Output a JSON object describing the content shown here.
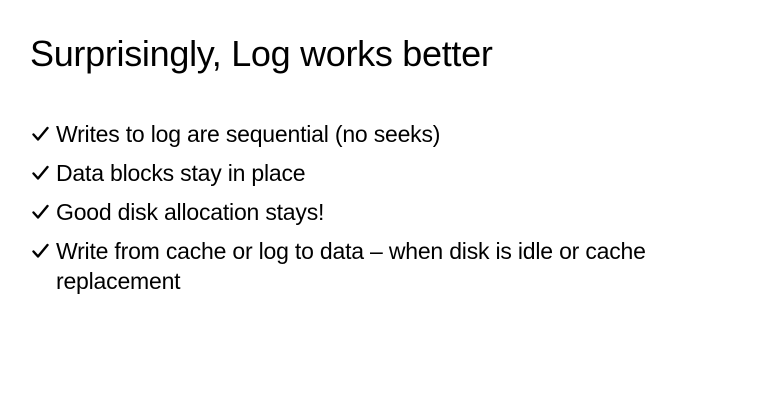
{
  "slide": {
    "title": "Surprisingly, Log works better",
    "bullets": [
      {
        "icon": "check-icon",
        "text": "Writes to log are sequential (no seeks)"
      },
      {
        "icon": "check-icon",
        "text": "Data blocks stay in place"
      },
      {
        "icon": "check-icon",
        "text": "Good disk allocation stays!"
      },
      {
        "icon": "check-icon",
        "text": "Write from cache or log to data – when disk is idle or cache replacement"
      }
    ]
  }
}
